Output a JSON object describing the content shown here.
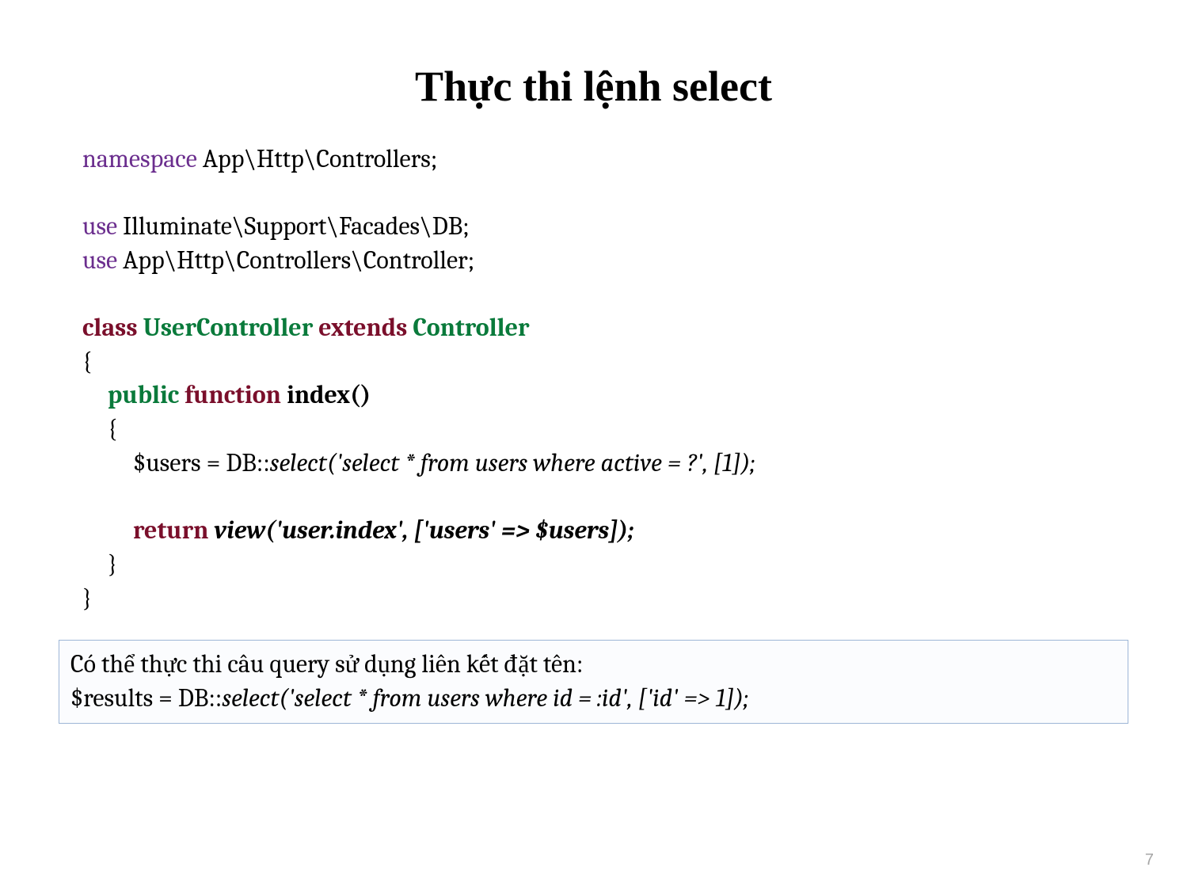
{
  "title": "Thực thi lệnh select",
  "code": {
    "line1_kw": "namespace",
    "line1_rest": " App\\Http\\Controllers;",
    "line3_kw": "use",
    "line3_rest": " Illuminate\\Support\\Facades\\DB;",
    "line4_kw": "use",
    "line4_rest": " App\\Http\\Controllers\\Controller;",
    "line6_class": "class ",
    "line6_name": "UserController ",
    "line6_extends": "extends ",
    "line6_parent": "Controller",
    "brace_open": "{",
    "line8_mod": "public ",
    "line8_fn": "function ",
    "line8_sig": "index()",
    "inner_brace_open": "{",
    "line10_lhs": "$users = DB::",
    "line10_call": "select('select * from users where active = ?', [1]);",
    "line12_kw": "return",
    "line12_call": " view('user.index', ['users' => $users]);",
    "inner_brace_close": "}",
    "brace_close": "}"
  },
  "note": {
    "line1": "Có thể thực thi câu query sử dụng liên kết đặt tên:",
    "line2_lhs": "$results = DB::",
    "line2_call": "select('select * from users where id = :id', ['id' => 1]);"
  },
  "page_number": "7"
}
